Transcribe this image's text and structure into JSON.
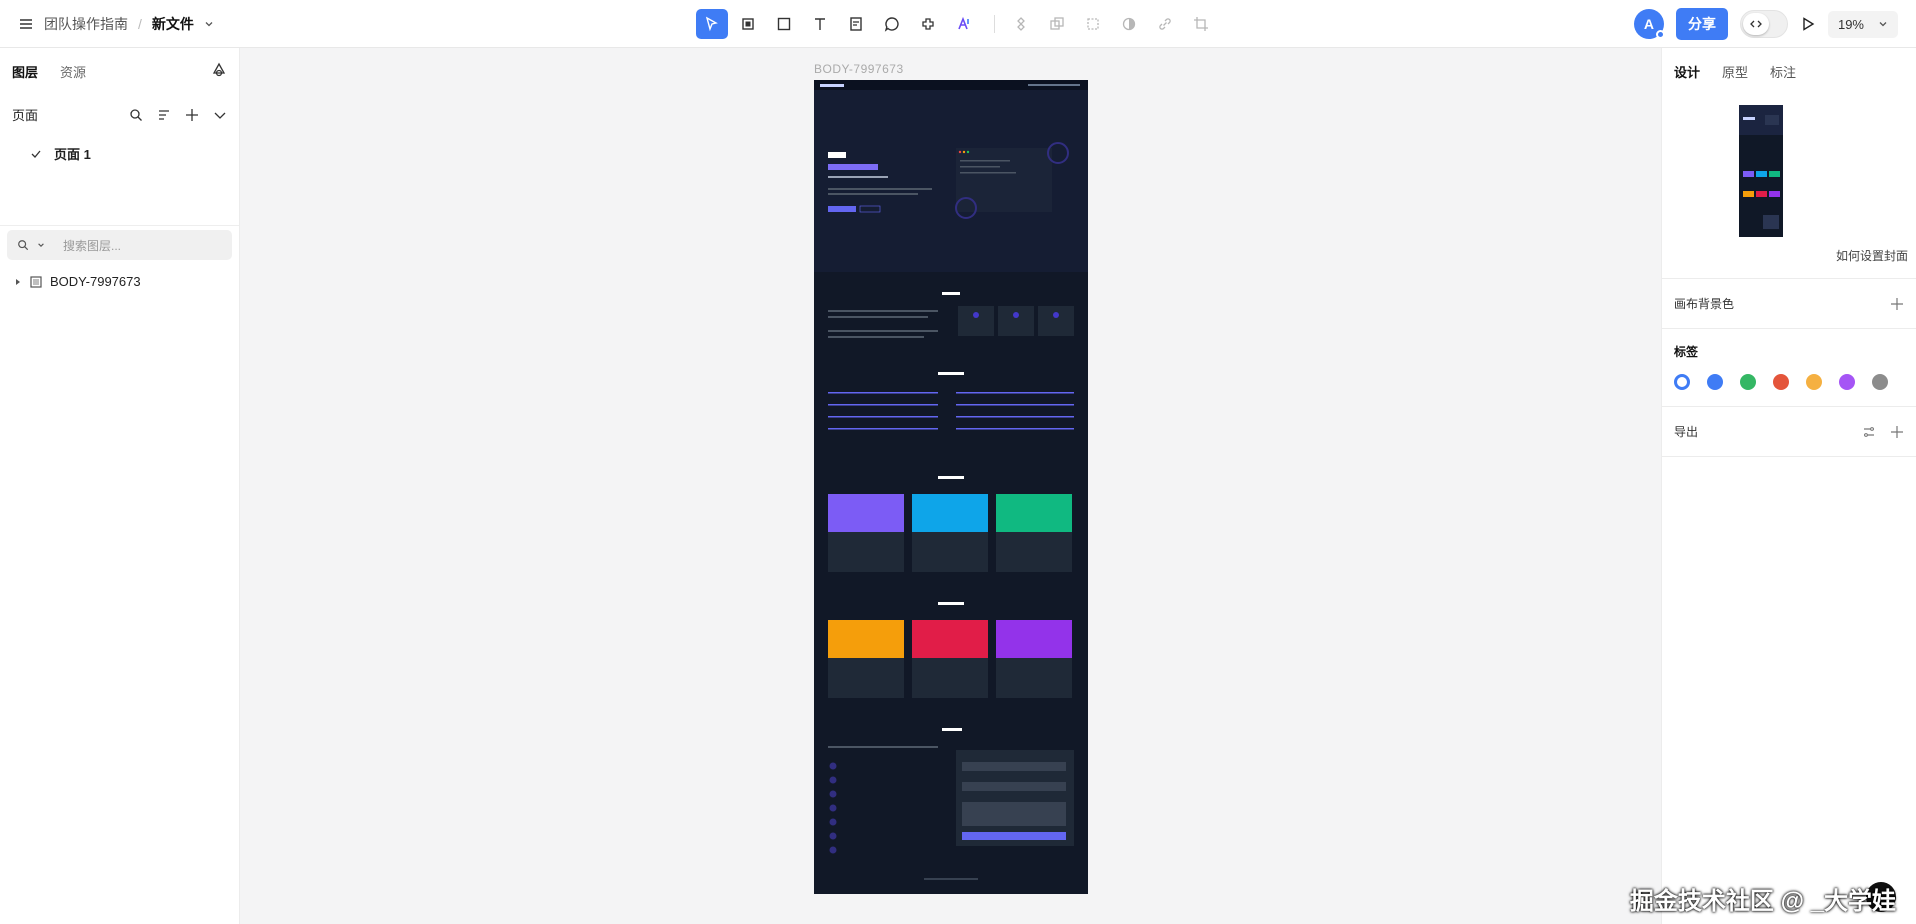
{
  "topbar": {
    "team_name": "团队操作指南",
    "separator": "/",
    "file_name": "新文件",
    "share_label": "分享",
    "avatar_initial": "A",
    "zoom_level": "19%",
    "accent_color": "#3f7cf5",
    "tools": [
      "move-icon",
      "frame-icon",
      "rectangle-icon",
      "text-icon",
      "note-icon",
      "comment-icon",
      "plugin-icon",
      "ai-icon",
      "component-icon",
      "instance-icon",
      "boolean-icon",
      "mask-icon",
      "link-icon",
      "crop-icon"
    ]
  },
  "left_panel": {
    "tabs": [
      "图层",
      "资源"
    ],
    "pages_label": "页面",
    "page_name": "页面 1",
    "search_placeholder": "搜索图层...",
    "layer_name": "BODY-7997673"
  },
  "canvas": {
    "frame_label": "BODY-7997673",
    "frame_background": "#111827"
  },
  "right_panel": {
    "tabs": [
      "设计",
      "原型",
      "标注"
    ],
    "cover_link": "如何设置封面",
    "canvas_bg_label": "画布背景色",
    "tags_label": "标签",
    "tag_colors": [
      "#ffffff",
      "#3f7cf5",
      "#34b764",
      "#e4553b",
      "#f5b041",
      "#a555f5",
      "#8c8c8c"
    ],
    "export_label": "导出"
  },
  "watermark": "掘金技术社区 @ _大学娃"
}
